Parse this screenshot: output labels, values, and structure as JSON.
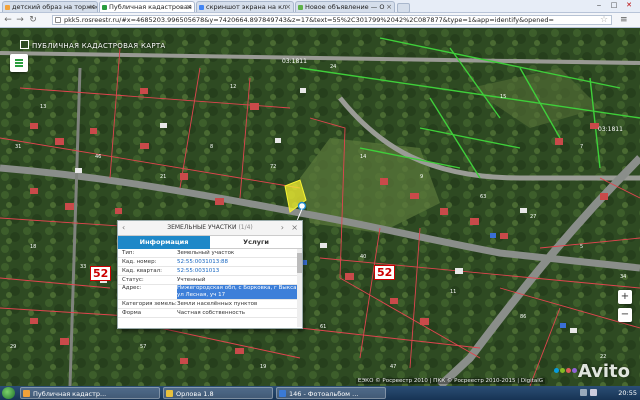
{
  "browser": {
    "tabs": [
      {
        "label": "детский образ на торжес",
        "active": false,
        "favicon_color": "#f2a23a"
      },
      {
        "label": "Публичная кадастровая",
        "active": true,
        "favicon_color": "#2a9d3e"
      },
      {
        "label": "скриншот экрана на кл",
        "active": false,
        "favicon_color": "#4285f4"
      },
      {
        "label": "Новое объявление — О",
        "active": false,
        "favicon_color": "#5fb24a"
      }
    ],
    "window_controls": {
      "minimize": "‒",
      "maximize": "□",
      "close": "✕"
    },
    "url_text": "pkk5.rosreestr.ru/#x=4685203.996505678&y=7420664.897849743&z=17&text=55%2C301799%2042%2C087877&type=1&app=identify&opened=",
    "back_icon": "arrow-left-icon",
    "forward_icon": "arrow-right-icon",
    "reload_icon": "reload-icon"
  },
  "map": {
    "title": "ПУБЛИЧНАЯ КАДАСТРОВАЯ КАРТА",
    "zoom_in": "+",
    "zoom_out": "−",
    "district_labels": [
      "52",
      "52"
    ],
    "cadastral_labels": [
      "03:1811",
      "03:1811"
    ],
    "copyright": "ЕЭКО © Росреестр 2010 | ПКК © Росреестр 2010-2015 | DigitalG",
    "watermark": "Avito",
    "watermark_dot_colors": [
      "#00aaff",
      "#97cf26",
      "#ff6163",
      "#a169f7"
    ],
    "colors": {
      "boundary_red": "#e0454f",
      "boundary_green": "#3fcf3a",
      "road": "#8a8e8a",
      "parcel_highlight": "#f7f332"
    }
  },
  "popup": {
    "header": "ЗЕМЕЛЬНЫЕ УЧАСТКИ",
    "counter": "(1/4)",
    "tab_info": "Информация",
    "tab_services": "Услуги",
    "rows": [
      {
        "key": "Тип:",
        "value": "Земельный участок"
      },
      {
        "key": "Кад. номер:",
        "value": "52:55:0031013:88"
      },
      {
        "key": "Кад. квартал:",
        "value": "52:55:0031013"
      },
      {
        "key": "Статус:",
        "value": "Учтенный"
      },
      {
        "key": "Адрес:",
        "value": "Нижегородская обл, с Борковка, г Выкса, ул Лесная, уч 17"
      },
      {
        "key": "Категория земель:",
        "value": "Земли населённых пунктов"
      },
      {
        "key": "Форма",
        "value": "Частная собственность"
      }
    ]
  },
  "taskbar": {
    "buttons": [
      {
        "label": "Публичная кадастр...",
        "icon_color": "#f2a23a"
      },
      {
        "label": "Орлова 1.8",
        "icon_color": "#e8c03c"
      },
      {
        "label": "146 - Фотоальбом ...",
        "icon_color": "#3a7ad6"
      }
    ],
    "clock": "20:55"
  }
}
